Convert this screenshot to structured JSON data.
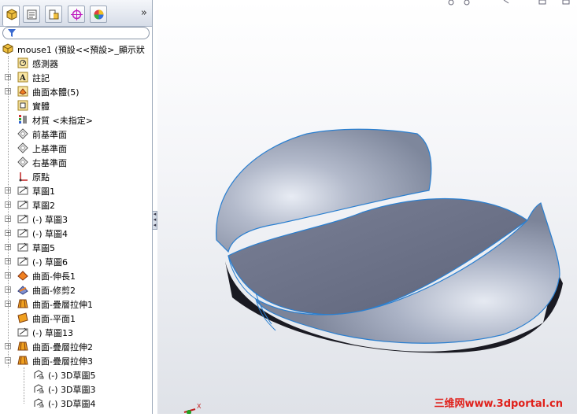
{
  "tabs": [
    {
      "icon": "feature-manager-icon",
      "active": true
    },
    {
      "icon": "property-manager-icon"
    },
    {
      "icon": "configuration-manager-icon"
    },
    {
      "icon": "dimxpert-manager-icon"
    },
    {
      "icon": "display-manager-icon"
    }
  ],
  "tabs_more": "»",
  "tree": {
    "root": "mouse1  (預設<<預設>_顯示狀",
    "items": [
      {
        "label": "感測器",
        "icon": "sensor-icon",
        "expand": false
      },
      {
        "label": "註記",
        "icon": "annotation-icon",
        "expand": true
      },
      {
        "label": "曲面本體(5)",
        "icon": "surface-bodies-icon",
        "expand": true
      },
      {
        "label": "實體",
        "icon": "solid-bodies-icon",
        "expand": false
      },
      {
        "label": "材質 <未指定>",
        "icon": "material-icon",
        "expand": false
      },
      {
        "label": "前基準面",
        "icon": "plane-icon",
        "expand": false
      },
      {
        "label": "上基準面",
        "icon": "plane-icon",
        "expand": false
      },
      {
        "label": "右基準面",
        "icon": "plane-icon",
        "expand": false
      },
      {
        "label": "原點",
        "icon": "origin-icon",
        "expand": false
      },
      {
        "label": "草圖1",
        "icon": "sketch-icon",
        "expand": true
      },
      {
        "label": "草圖2",
        "icon": "sketch-icon",
        "expand": true
      },
      {
        "label": "(-) 草圖3",
        "icon": "sketch-icon",
        "expand": true
      },
      {
        "label": "(-) 草圖4",
        "icon": "sketch-icon",
        "expand": true
      },
      {
        "label": "草圖5",
        "icon": "sketch-icon",
        "expand": true
      },
      {
        "label": "(-) 草圖6",
        "icon": "sketch-icon",
        "expand": true
      },
      {
        "label": "曲面-伸長1",
        "icon": "surface-extrude-icon",
        "expand": true
      },
      {
        "label": "曲面-修剪2",
        "icon": "surface-trim-icon",
        "expand": true
      },
      {
        "label": "曲面-疊層拉伸1",
        "icon": "surface-loft-icon",
        "expand": true
      },
      {
        "label": "曲面-平面1",
        "icon": "planar-surface-icon",
        "expand": false
      },
      {
        "label": "(-) 草圖13",
        "icon": "sketch-icon",
        "expand": false
      },
      {
        "label": "曲面-疊層拉伸2",
        "icon": "surface-loft-icon",
        "expand": true
      },
      {
        "label": "曲面-疊層拉伸3",
        "icon": "surface-loft-icon",
        "expand": "open"
      },
      {
        "label": "(-) 3D草圖5",
        "icon": "3d-sketch-icon",
        "child": true
      },
      {
        "label": "(-) 3D草圖3",
        "icon": "3d-sketch-icon",
        "child": true
      },
      {
        "label": "(-) 3D草圖4",
        "icon": "3d-sketch-icon",
        "child": true
      }
    ]
  },
  "watermark": "三维网www.3dportal.cn",
  "axis_label": "X",
  "colors": {
    "surface": "#9aa3b7",
    "edge": "#2a7fd0",
    "watermark": "#e0201a"
  }
}
